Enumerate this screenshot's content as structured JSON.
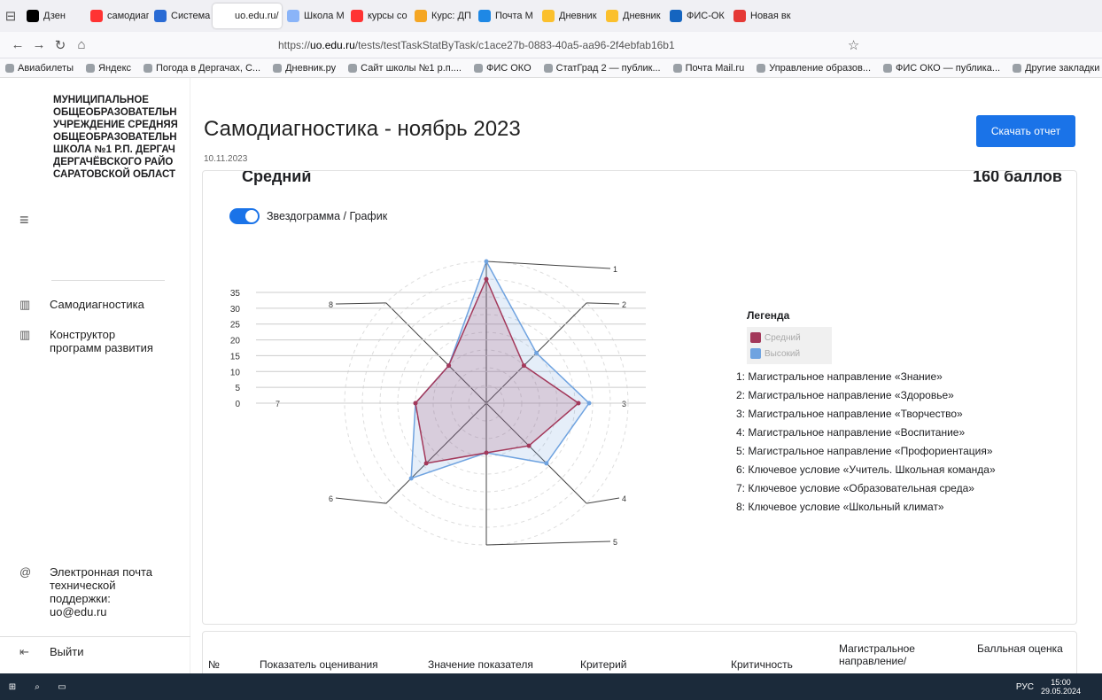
{
  "tabs": [
    {
      "label": "Дзен",
      "color": "#000000"
    },
    {
      "label": "самодиаг",
      "color": "#ff3333"
    },
    {
      "label": "Система",
      "color": "#2a6bd4"
    },
    {
      "label": "uo.edu.ru/",
      "color": "#ffffff",
      "active": true
    },
    {
      "label": "Школа М",
      "color": "#8ab4f8"
    },
    {
      "label": "курсы со",
      "color": "#ff3333"
    },
    {
      "label": "Курс: ДП",
      "color": "#f5a623"
    },
    {
      "label": "Почта М",
      "color": "#1e88e5"
    },
    {
      "label": "Дневник",
      "color": "#fbc02d"
    },
    {
      "label": "Дневник",
      "color": "#fbc02d"
    },
    {
      "label": "ФИС-ОК",
      "color": "#1565c0"
    },
    {
      "label": "Новая вк",
      "color": "#e53935"
    }
  ],
  "url": {
    "prefix": "https://",
    "domain": "uo.edu.ru",
    "path": "/tests/testTaskStatByTask/c1ace27b-0883-40a5-aa96-2f4ebfab16b1"
  },
  "bookmarks": [
    "Авиабилеты",
    "Яндекс",
    "Погода в Дергачах, С...",
    "Дневник.ру",
    "Сайт школы №1 р.п....",
    "ФИС ОКО",
    "СтатГрад 2 — публик...",
    "Почта Mail.ru",
    "Управление образов...",
    "ФИС ОКО — публика...",
    "Другие закладки"
  ],
  "sidebar": {
    "school": [
      "МУНИЦИПАЛЬНОЕ",
      "ОБЩЕОБРАЗОВАТЕЛЬН",
      "УЧРЕЖДЕНИЕ СРЕДНЯЯ",
      "ОБЩЕОБРАЗОВАТЕЛЬН",
      "ШКОЛА №1 Р.П. ДЕРГАЧ",
      "ДЕРГАЧЁВСКОГО РАЙО",
      "САРАТОВСКОЙ ОБЛАСТ"
    ],
    "menu": [
      "Самодиагностика",
      "Конструктор программ развития"
    ],
    "support": "Электронная почта технической поддержки: uo@edu.ru",
    "logout": "Выйти"
  },
  "page": {
    "title": "Самодиагностика - ноябрь 2023",
    "date": "10.11.2023",
    "download": "Скачать отчет",
    "level": "Средний",
    "score": "160 баллов",
    "toggle_label": "Звездограмма / График"
  },
  "legend": {
    "title": "Легенда",
    "items": [
      {
        "label": "Средний",
        "color": "#a3385a"
      },
      {
        "label": "Высокий",
        "color": "#6fa3e0"
      }
    ]
  },
  "axes": [
    "1: Магистральное направление «Знание»",
    "2: Магистральное направление «Здоровье»",
    "3: Магистральное направление «Творчество»",
    "4: Магистральное направление «Воспитание»",
    "5: Магистральное направление «Профориентация»",
    "6: Ключевое условие «Учитель. Школьная команда»",
    "7: Ключевое условие «Образовательная среда»",
    "8: Ключевое условие «Школьный климат»"
  ],
  "chart_data": {
    "type": "radar",
    "categories": [
      "1",
      "2",
      "3",
      "4",
      "5",
      "6",
      "7",
      "8"
    ],
    "yticks": [
      0,
      5,
      10,
      15,
      20,
      25,
      30,
      35
    ],
    "ylim": [
      0,
      40
    ],
    "series": [
      {
        "name": "Средний",
        "color": "#a3385a",
        "values": [
          35,
          15,
          26,
          17,
          14,
          24,
          20,
          15
        ]
      },
      {
        "name": "Высокий",
        "color": "#6fa3e0",
        "values": [
          40,
          20,
          29,
          24,
          14,
          30,
          20,
          15
        ]
      }
    ]
  },
  "table_headers": [
    "№",
    "Показатель оценивания",
    "Значение показателя",
    "Критерий",
    "Критичность",
    "Магистральное направление/",
    "Балльная оценка"
  ],
  "taskbar": {
    "lang": "РУС",
    "time": "15:00",
    "date": "29.05.2024"
  }
}
